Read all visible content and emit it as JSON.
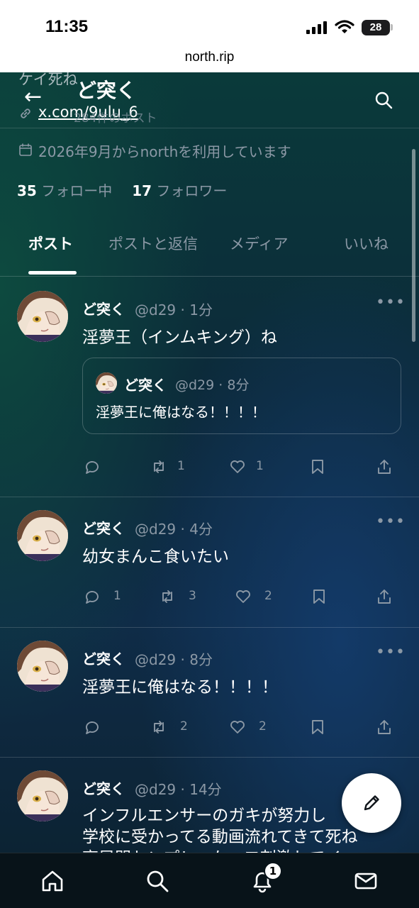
{
  "status_bar": {
    "time": "11:35",
    "battery": "28"
  },
  "browser": {
    "url": "north.rip"
  },
  "profile": {
    "header_scroll_text": "ケイ死ね",
    "display_name": "ど突く",
    "link": "x.com/9ulu_6",
    "post_count_ghost": "284件のポスト",
    "joined": "2026年9月からnorthを利用しています",
    "following_count": "35",
    "following_label": "フォロー中",
    "followers_count": "17",
    "followers_label": "フォロワー"
  },
  "tabs": [
    {
      "label": "ポスト",
      "active": true
    },
    {
      "label": "ポストと返信",
      "active": false
    },
    {
      "label": "メディア",
      "active": false
    },
    {
      "label": "いいね",
      "active": false
    }
  ],
  "posts": [
    {
      "name": "ど突く",
      "meta": "@d29 · 1分",
      "text": "淫夢王（インムキング）ね",
      "quote": {
        "name": "ど突く",
        "meta": "@d29 · 8分",
        "text": "淫夢王に俺はなる！！！！"
      },
      "replies": "",
      "reposts": "1",
      "likes": "1"
    },
    {
      "name": "ど突く",
      "meta": "@d29 · 4分",
      "text": "幼女まんこ食いたい",
      "replies": "1",
      "reposts": "3",
      "likes": "2"
    },
    {
      "name": "ど突く",
      "meta": "@d29 · 8分",
      "text": "淫夢王に俺はなる！！！！",
      "replies": "",
      "reposts": "2",
      "likes": "2"
    },
    {
      "name": "ど突く",
      "meta": "@d29 · 14分",
      "text_lines": [
        "インフルエンサーのガキが努力し",
        "学校に受かってる動画流れてきて死ね",
        "高早門センプレ…ケーフ刺激してイ"
      ]
    }
  ],
  "nav": {
    "notification_badge": "1"
  },
  "icons": [
    "back-arrow-icon",
    "link-icon",
    "search-icon",
    "calendar-icon",
    "more-icon",
    "reply-icon",
    "repost-icon",
    "like-icon",
    "bookmark-icon",
    "share-icon",
    "compose-pencil-icon",
    "home-icon",
    "bell-icon",
    "mail-icon"
  ],
  "colors": {
    "text_primary": "#ffffff",
    "text_secondary": "#8b98a5",
    "bg_top": "#0a3a3a",
    "bg_bottom": "#0f2c48"
  }
}
